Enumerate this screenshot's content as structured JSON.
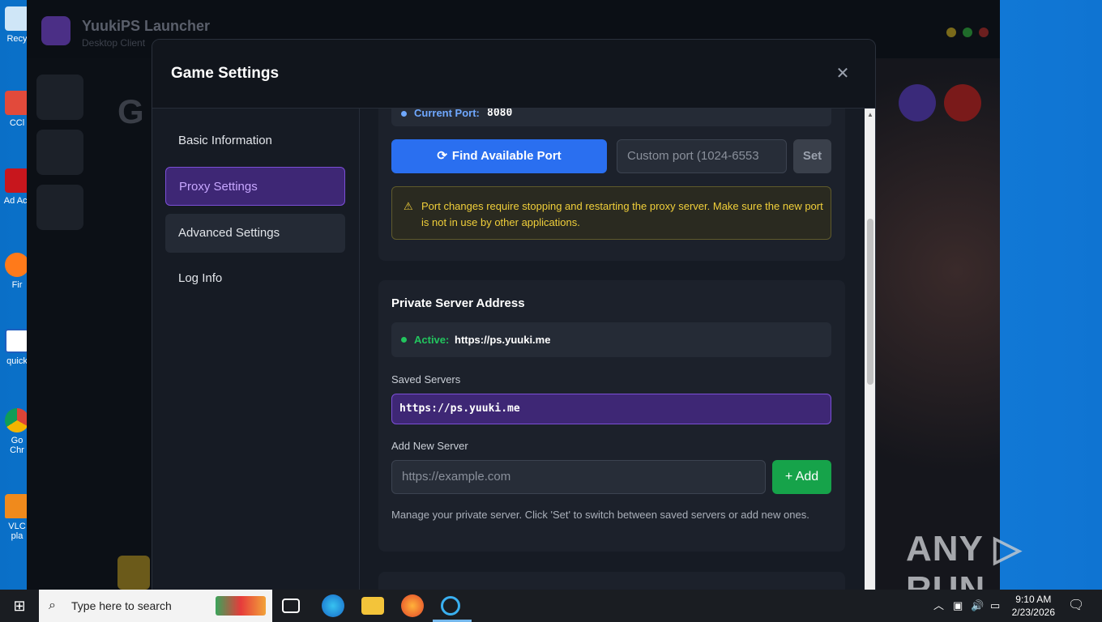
{
  "modal": {
    "title": "Game Settings",
    "close_glyph": "✕"
  },
  "sidebar": {
    "items": [
      {
        "label": "Basic Information"
      },
      {
        "label": "Proxy Settings"
      },
      {
        "label": "Advanced Settings"
      },
      {
        "label": "Log Info"
      }
    ],
    "active_index": 1
  },
  "port": {
    "label": "Current Port:",
    "value": "8080",
    "find_button": "Find Available Port",
    "custom_placeholder": "Custom port (1024-6553",
    "set_button": "Set",
    "warning": "Port changes require stopping and restarting the proxy server. Make sure the new port is not in use by other applications."
  },
  "private_server": {
    "title": "Private Server Address",
    "active_label": "Active:",
    "active_url": "https://ps.yuuki.me",
    "saved_label": "Saved Servers",
    "saved_servers": [
      "https://ps.yuuki.me"
    ],
    "add_label": "Add New Server",
    "add_placeholder": "https://example.com",
    "add_button": "+ Add",
    "help": "Manage your private server. Click 'Set' to switch between saved servers or add new ones."
  },
  "background_app": {
    "title": "YuukiPS Launcher",
    "subtitle": "Desktop Client"
  },
  "desktop_icons": [
    "Recy",
    "CCl",
    "Ad Acr",
    "Fir",
    "quick",
    "Go Chr",
    "VLC pla"
  ],
  "taskbar": {
    "search_placeholder": "Type here to search",
    "time": "9:10 AM",
    "date": "2/23/2026"
  },
  "watermark": "ANY ▷ RUN",
  "colors": {
    "accent_purple": "#3e2775",
    "accent_blue": "#2a6ff0",
    "accent_green": "#16a34a",
    "warning_yellow": "#f0cf3a"
  }
}
